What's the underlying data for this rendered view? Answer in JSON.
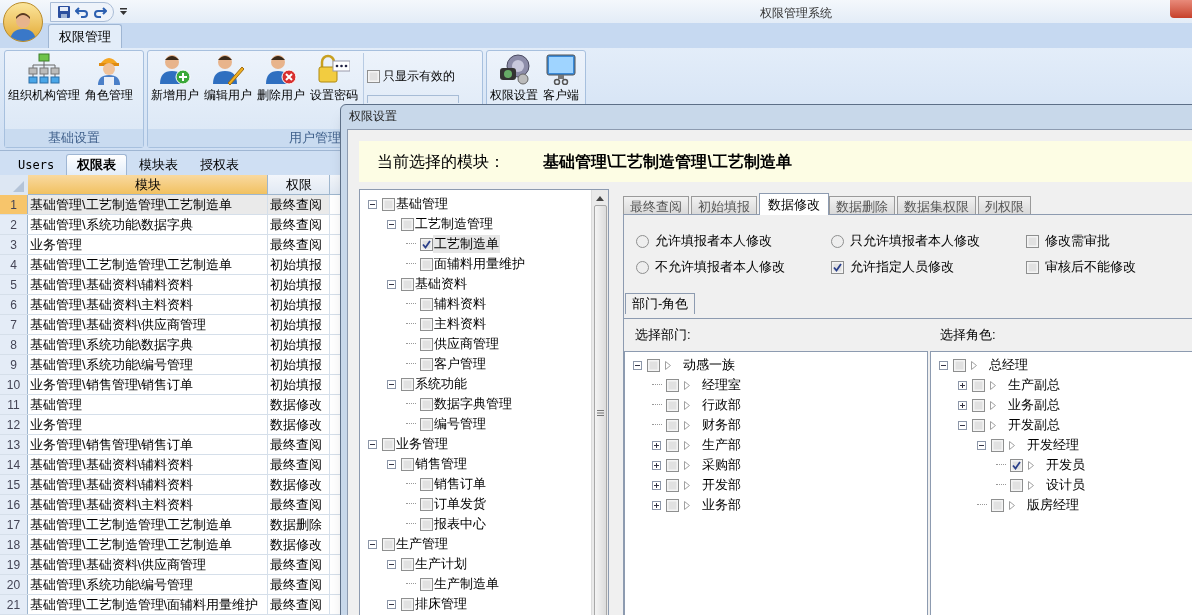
{
  "window": {
    "title": "权限管理系统"
  },
  "ribbon": {
    "tabs": [
      {
        "label": "权限管理",
        "selected": true
      }
    ],
    "groups": [
      {
        "label": "基础设置",
        "buttons": [
          "组织机构管理",
          "角色管理"
        ]
      },
      {
        "label": "用户管理",
        "buttons": [
          "新增用户",
          "编辑用户",
          "删除用户",
          "设置密码"
        ],
        "filter_checkbox": {
          "label": "只显示有效的",
          "checked": false
        }
      },
      {
        "buttons": [
          "权限设置",
          "客户端"
        ]
      }
    ]
  },
  "sheet_tabs": [
    {
      "label": "Users",
      "selected": false
    },
    {
      "label": "权限表",
      "selected": true
    },
    {
      "label": "模块表",
      "selected": false
    },
    {
      "label": "授权表",
      "selected": false
    }
  ],
  "grid": {
    "columns": [
      {
        "label": "模块",
        "selected": true
      },
      {
        "label": "权限",
        "selected": false
      }
    ],
    "rows": [
      {
        "number": "1",
        "cells": [
          "基础管理\\工艺制造管理\\工艺制造单",
          "最终查阅"
        ],
        "selected": true
      },
      {
        "number": "2",
        "cells": [
          "基础管理\\系统功能\\数据字典",
          "最终查阅"
        ],
        "selected": false
      },
      {
        "number": "3",
        "cells": [
          "业务管理",
          "最终查阅"
        ],
        "selected": false
      },
      {
        "number": "4",
        "cells": [
          "基础管理\\工艺制造管理\\工艺制造单",
          "初始填报"
        ],
        "selected": false
      },
      {
        "number": "5",
        "cells": [
          "基础管理\\基础资料\\辅料资料",
          "初始填报"
        ],
        "selected": false
      },
      {
        "number": "6",
        "cells": [
          "基础管理\\基础资料\\主料资料",
          "初始填报"
        ],
        "selected": false
      },
      {
        "number": "7",
        "cells": [
          "基础管理\\基础资料\\供应商管理",
          "初始填报"
        ],
        "selected": false
      },
      {
        "number": "8",
        "cells": [
          "基础管理\\系统功能\\数据字典",
          "初始填报"
        ],
        "selected": false
      },
      {
        "number": "9",
        "cells": [
          "基础管理\\系统功能\\编号管理",
          "初始填报"
        ],
        "selected": false
      },
      {
        "number": "10",
        "cells": [
          "业务管理\\销售管理\\销售订单",
          "初始填报"
        ],
        "selected": false
      },
      {
        "number": "11",
        "cells": [
          "基础管理",
          "数据修改"
        ],
        "selected": false
      },
      {
        "number": "12",
        "cells": [
          "业务管理",
          "数据修改"
        ],
        "selected": false
      },
      {
        "number": "13",
        "cells": [
          "业务管理\\销售管理\\销售订单",
          "最终查阅"
        ],
        "selected": false
      },
      {
        "number": "14",
        "cells": [
          "基础管理\\基础资料\\辅料资料",
          "最终查阅"
        ],
        "selected": false
      },
      {
        "number": "15",
        "cells": [
          "基础管理\\基础资料\\辅料资料",
          "数据修改"
        ],
        "selected": false
      },
      {
        "number": "16",
        "cells": [
          "基础管理\\基础资料\\主料资料",
          "最终查阅"
        ],
        "selected": false
      },
      {
        "number": "17",
        "cells": [
          "基础管理\\工艺制造管理\\工艺制造单",
          "数据删除"
        ],
        "selected": false
      },
      {
        "number": "18",
        "cells": [
          "基础管理\\工艺制造管理\\工艺制造单",
          "数据修改"
        ],
        "selected": false
      },
      {
        "number": "19",
        "cells": [
          "基础管理\\基础资料\\供应商管理",
          "最终查阅"
        ],
        "selected": false
      },
      {
        "number": "20",
        "cells": [
          "基础管理\\系统功能\\编号管理",
          "最终查阅"
        ],
        "selected": false
      },
      {
        "number": "21",
        "cells": [
          "基础管理\\工艺制造管理\\面辅料用量维护",
          "最终查阅"
        ],
        "selected": false
      }
    ]
  },
  "dialog": {
    "title": "权限设置",
    "current_module_label": "当前选择的模块：",
    "current_module": "基础管理\\工艺制造管理\\工艺制造单",
    "module_tree": [
      {
        "label": "基础管理",
        "checked": false,
        "selected": false,
        "expanded": true,
        "children": [
          {
            "label": "工艺制造管理",
            "checked": false,
            "selected": false,
            "expanded": true,
            "children": [
              {
                "label": "工艺制造单",
                "checked": true,
                "selected": true
              },
              {
                "label": "面辅料用量维护",
                "checked": false,
                "selected": false
              }
            ]
          },
          {
            "label": "基础资料",
            "checked": false,
            "selected": false,
            "expanded": true,
            "children": [
              {
                "label": "辅料资料",
                "checked": false,
                "selected": false
              },
              {
                "label": "主料资料",
                "checked": false,
                "selected": false
              },
              {
                "label": "供应商管理",
                "checked": false,
                "selected": false
              },
              {
                "label": "客户管理",
                "checked": false,
                "selected": false
              }
            ]
          },
          {
            "label": "系统功能",
            "checked": false,
            "selected": false,
            "expanded": true,
            "children": [
              {
                "label": "数据字典管理",
                "checked": false,
                "selected": false
              },
              {
                "label": "编号管理",
                "checked": false,
                "selected": false
              }
            ]
          }
        ]
      },
      {
        "label": "业务管理",
        "checked": false,
        "selected": false,
        "expanded": true,
        "children": [
          {
            "label": "销售管理",
            "checked": false,
            "selected": false,
            "expanded": true,
            "children": [
              {
                "label": "销售订单",
                "checked": false,
                "selected": false
              },
              {
                "label": "订单发货",
                "checked": false,
                "selected": false
              },
              {
                "label": "报表中心",
                "checked": false,
                "selected": false
              }
            ]
          }
        ]
      },
      {
        "label": "生产管理",
        "checked": false,
        "selected": false,
        "expanded": true,
        "children": [
          {
            "label": "生产计划",
            "checked": false,
            "selected": false,
            "expanded": true,
            "children": [
              {
                "label": "生产制造单",
                "checked": false,
                "selected": false
              }
            ]
          },
          {
            "label": "排床管理",
            "checked": false,
            "selected": false,
            "expanded": true
          }
        ]
      }
    ],
    "tabs": [
      {
        "label": "最终查阅",
        "selected": false
      },
      {
        "label": "初始填报",
        "selected": false
      },
      {
        "label": "数据修改",
        "selected": true
      },
      {
        "label": "数据删除",
        "selected": false
      },
      {
        "label": "数据集权限",
        "selected": false
      },
      {
        "label": "列权限",
        "selected": false
      }
    ],
    "options": [
      {
        "kind": "radio",
        "label": "允许填报者本人修改",
        "checked": false
      },
      {
        "kind": "radio",
        "label": "只允许填报者本人修改",
        "checked": false
      },
      {
        "kind": "checkbox",
        "label": "修改需审批",
        "checked": false
      },
      {
        "kind": "radio",
        "label": "不允许填报者本人修改",
        "checked": false
      },
      {
        "kind": "checkbox",
        "label": "允许指定人员修改",
        "checked": true
      },
      {
        "kind": "checkbox",
        "label": "审核后不能修改",
        "checked": false
      }
    ],
    "sub_tabs": [
      {
        "label": "部门-角色",
        "selected": true
      }
    ],
    "department_label": "选择部门:",
    "department_tree": [
      {
        "label": "动感一族",
        "checked": false,
        "expanded": true,
        "children": [
          {
            "label": "经理室",
            "checked": false
          },
          {
            "label": "行政部",
            "checked": false
          },
          {
            "label": "财务部",
            "checked": false
          },
          {
            "label": "生产部",
            "checked": false,
            "expanded": false
          },
          {
            "label": "采购部",
            "checked": false,
            "expanded": false
          },
          {
            "label": "开发部",
            "checked": false,
            "expanded": false
          },
          {
            "label": "业务部",
            "checked": false,
            "expanded": false
          }
        ]
      }
    ],
    "role_label": "选择角色:",
    "role_tree": [
      {
        "label": "总经理",
        "checked": false,
        "expanded": true,
        "children": [
          {
            "label": "生产副总",
            "checked": false,
            "expanded": false
          },
          {
            "label": "业务副总",
            "checked": false,
            "expanded": false
          },
          {
            "label": "开发副总",
            "checked": false,
            "expanded": true,
            "children": [
              {
                "label": "开发经理",
                "checked": false,
                "expanded": true,
                "children": [
                  {
                    "label": "开发员",
                    "checked": true
                  },
                  {
                    "label": "设计员",
                    "checked": false
                  }
                ]
              },
              {
                "label": "版房经理",
                "checked": false
              }
            ]
          }
        ]
      }
    ]
  }
}
